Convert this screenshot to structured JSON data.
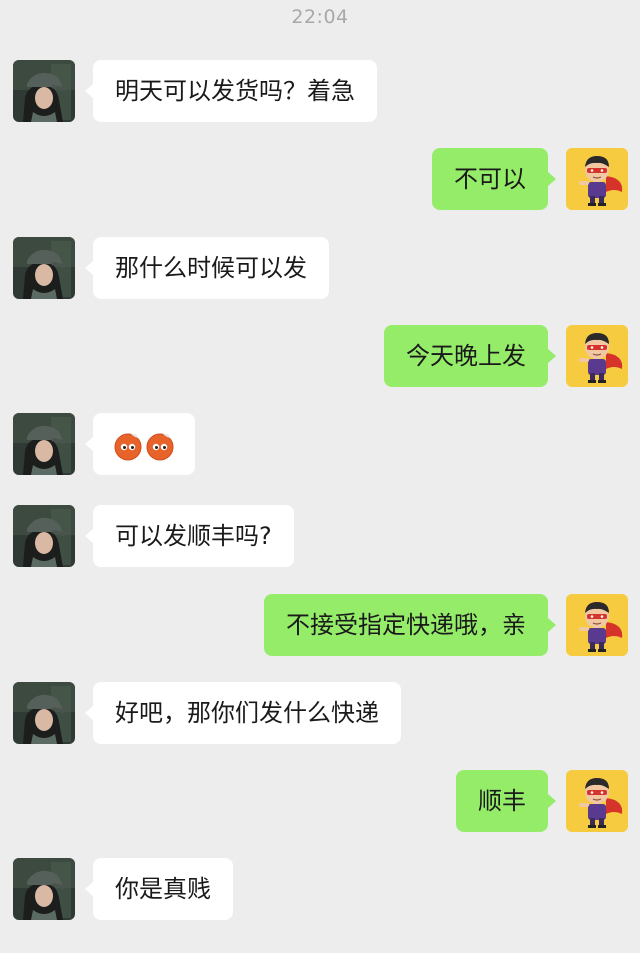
{
  "status": {
    "time": "22:04"
  },
  "colors": {
    "background": "#ededed",
    "incoming_bubble": "#ffffff",
    "outgoing_bubble": "#95ec69"
  },
  "messages": [
    {
      "side": "left",
      "text": "明天可以发货吗？着急",
      "avatar_icon": "girl-cap-avatar-icon"
    },
    {
      "side": "right",
      "text": "不可以",
      "avatar_icon": "cartoon-superhero-avatar-icon"
    },
    {
      "side": "left",
      "text": "那什么时候可以发",
      "avatar_icon": "girl-cap-avatar-icon"
    },
    {
      "side": "right",
      "text": "今天晚上发",
      "avatar_icon": "cartoon-superhero-avatar-icon"
    },
    {
      "side": "left",
      "text": "",
      "emoji_icon": "orange-face-emoji-icon",
      "emoji_count": 2,
      "avatar_icon": "girl-cap-avatar-icon"
    },
    {
      "side": "left",
      "text": "可以发顺丰吗?",
      "avatar_icon": "girl-cap-avatar-icon"
    },
    {
      "side": "right",
      "text": "不接受指定快递哦，亲",
      "avatar_icon": "cartoon-superhero-avatar-icon"
    },
    {
      "side": "left",
      "text": "好吧，那你们发什么快递",
      "avatar_icon": "girl-cap-avatar-icon"
    },
    {
      "side": "right",
      "text": "顺丰",
      "avatar_icon": "cartoon-superhero-avatar-icon"
    },
    {
      "side": "left",
      "text": "你是真贱",
      "avatar_icon": "girl-cap-avatar-icon"
    }
  ]
}
